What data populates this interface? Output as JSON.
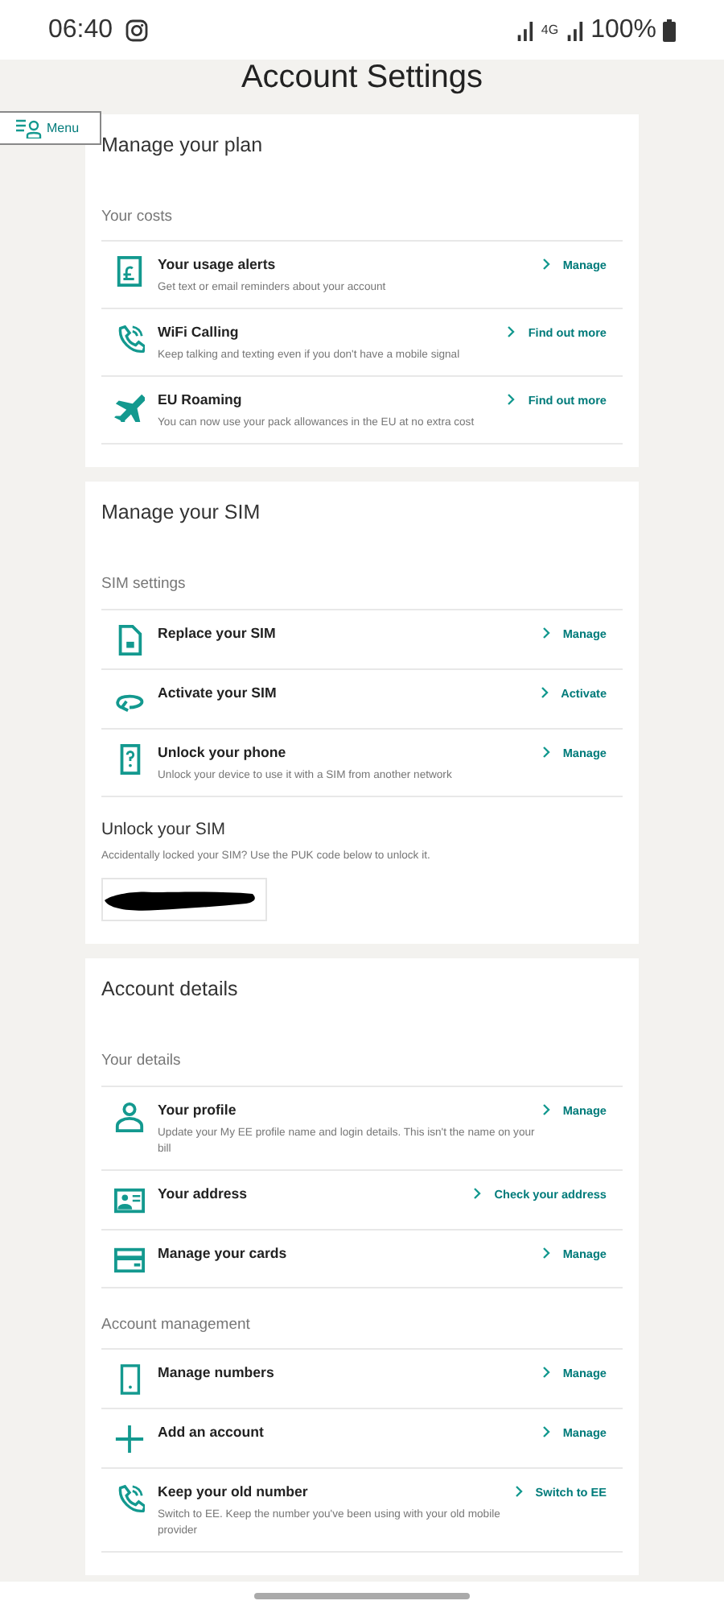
{
  "status_bar": {
    "time": "06:40",
    "network": "4G",
    "battery": "100%"
  },
  "page_title": "Account Settings",
  "menu_button": {
    "label": "Menu"
  },
  "cards": [
    {
      "title": "Manage your plan",
      "groups": [
        {
          "label": "Your costs",
          "items": [
            {
              "kind": "bill",
              "title": "Your usage alerts",
              "description": "Get text or email reminders about your account",
              "action": "Manage"
            },
            {
              "kind": "wifi-call",
              "title": "WiFi Calling",
              "description": "Keep talking and texting even if you don't have a mobile signal",
              "action": "Find out more"
            },
            {
              "kind": "plane",
              "title": "EU Roaming",
              "description": "You can now use your pack allowances in the EU at no extra cost",
              "action": "Find out more"
            }
          ]
        }
      ]
    },
    {
      "title": "Manage your SIM",
      "groups": [
        {
          "label": "SIM settings",
          "items": [
            {
              "kind": "sim",
              "title": "Replace your SIM",
              "action": "Manage"
            },
            {
              "kind": "activate",
              "title": "Activate your SIM",
              "action": "Activate"
            },
            {
              "kind": "phone-question",
              "title": "Unlock your phone",
              "description": "Unlock your device to use it with a SIM from another network",
              "action": "Manage"
            }
          ]
        }
      ],
      "puk": {
        "title": "Unlock your SIM",
        "description": "Accidentally locked your SIM? Use the PUK code below to unlock it.",
        "redacted": true
      }
    },
    {
      "title": "Account details",
      "groups": [
        {
          "label": "Your details",
          "items": [
            {
              "kind": "person",
              "title": "Your profile",
              "description": "Update your My EE profile name and login details. This isn't the name on your bill",
              "action": "Manage"
            },
            {
              "kind": "address",
              "title": "Your address",
              "action": "Check your address"
            },
            {
              "kind": "card",
              "title": "Manage your cards",
              "action": "Manage"
            }
          ]
        },
        {
          "label": "Account management",
          "items": [
            {
              "kind": "mobile",
              "title": "Manage numbers",
              "action": "Manage"
            },
            {
              "kind": "plus",
              "title": "Add an account",
              "action": "Manage"
            },
            {
              "kind": "wifi-call",
              "title": "Keep your old number",
              "description": "Switch to EE. Keep the number you've been using with your old mobile provider",
              "action": "Switch to EE"
            }
          ]
        }
      ]
    }
  ]
}
